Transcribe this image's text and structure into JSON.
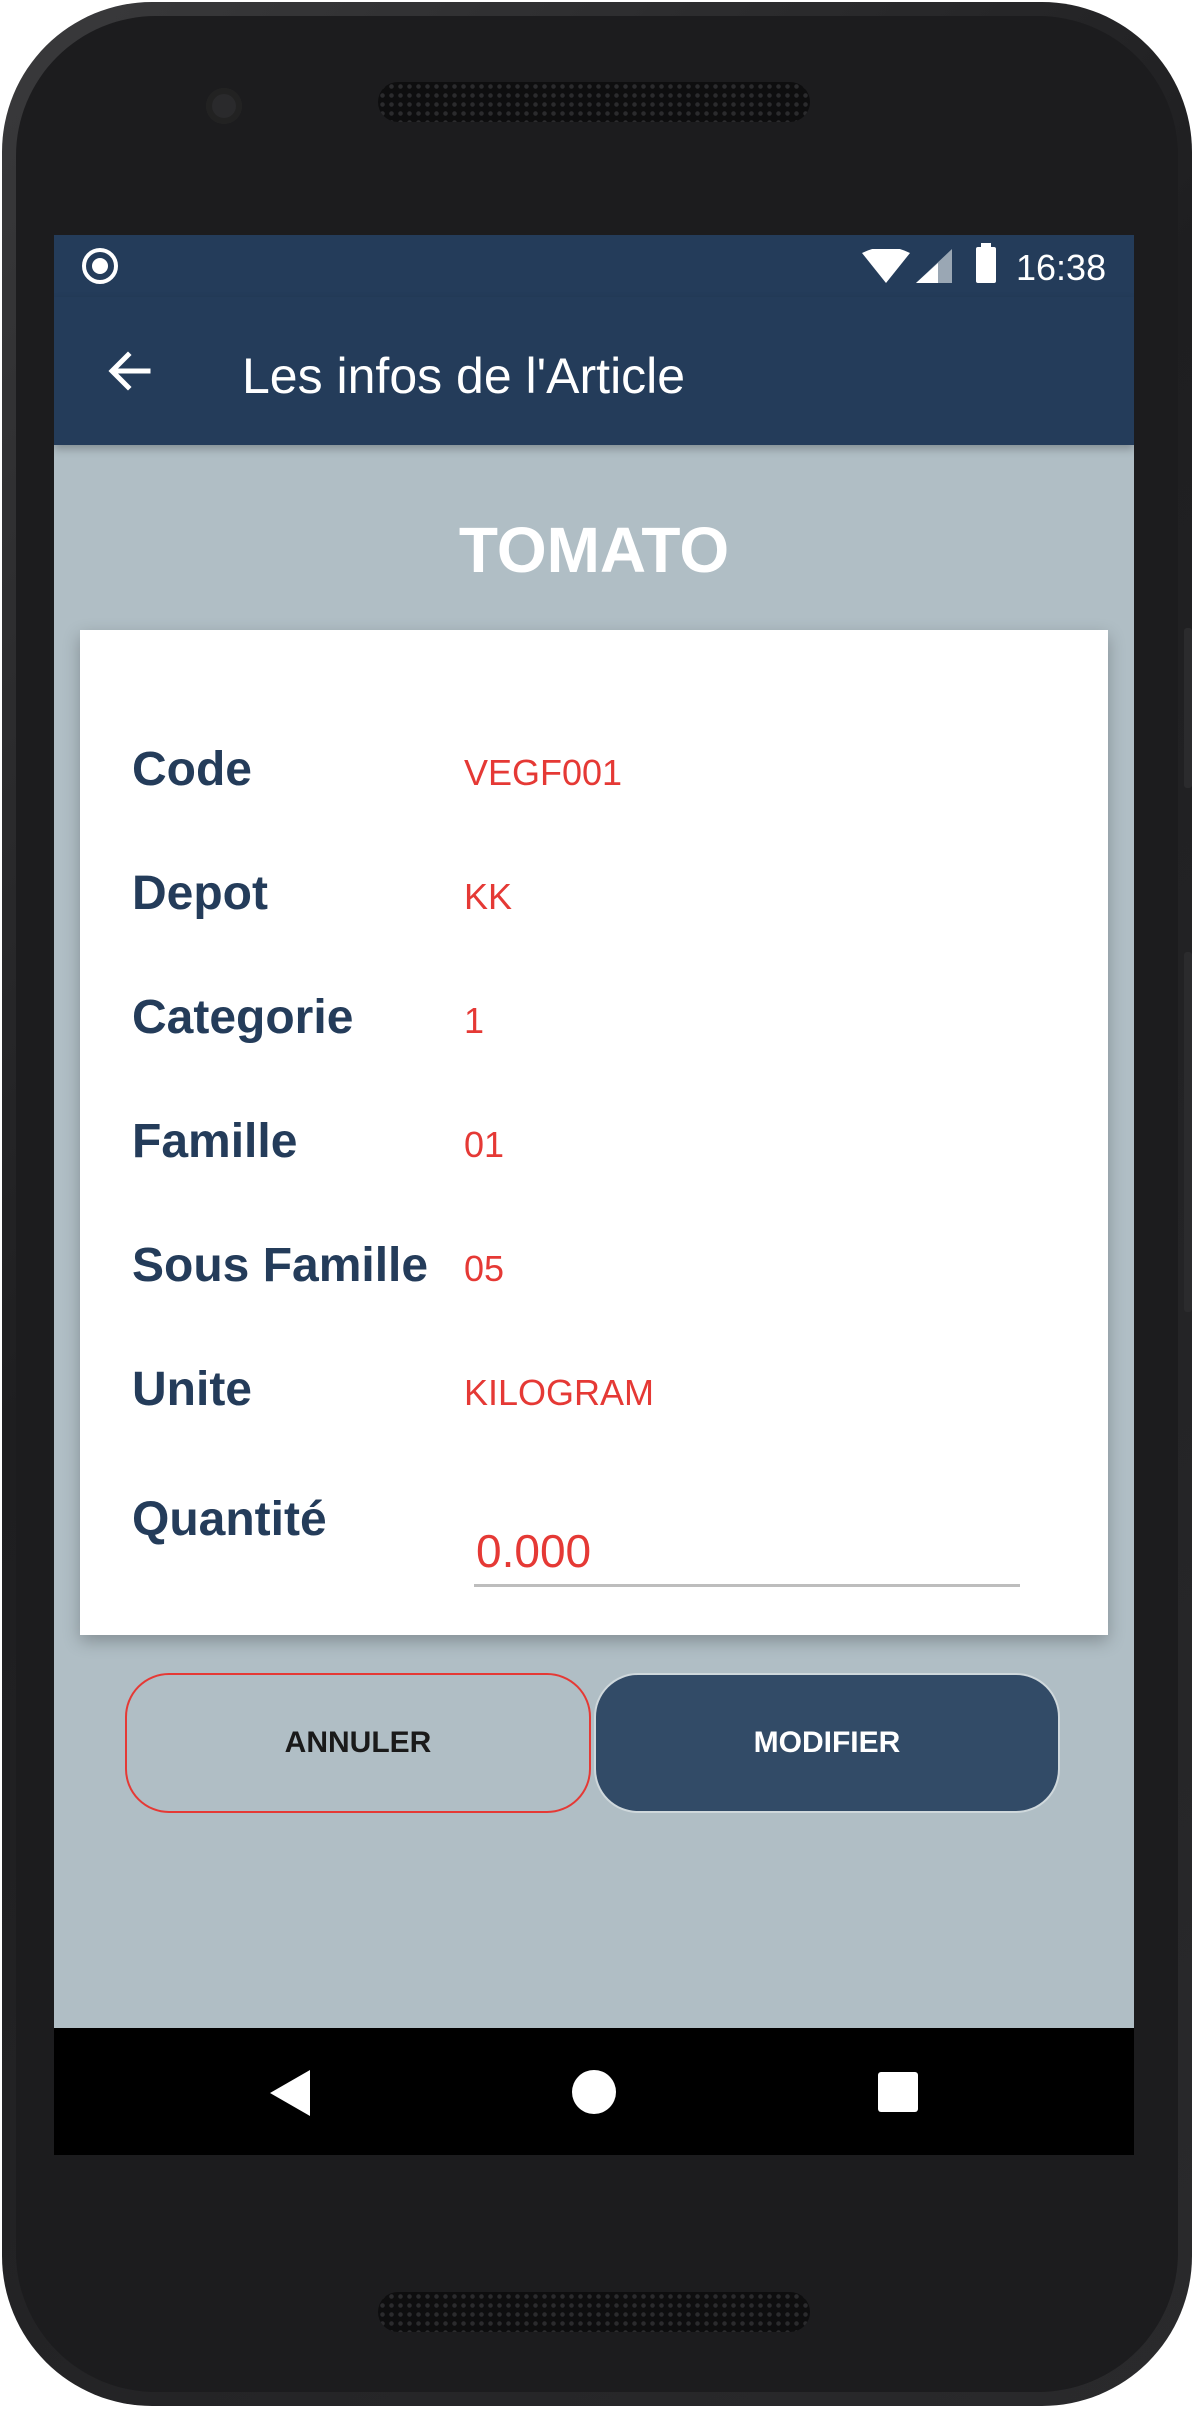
{
  "status_bar": {
    "time": "16:38"
  },
  "app_bar": {
    "title": "Les infos de l'Article"
  },
  "article": {
    "name": "TOMATO",
    "fields": [
      {
        "label": "Code",
        "value": "VEGF001"
      },
      {
        "label": "Depot",
        "value": "KK"
      },
      {
        "label": "Categorie",
        "value": "1"
      },
      {
        "label": "Famille",
        "value": "01"
      },
      {
        "label": "Sous Famille",
        "value": "05"
      },
      {
        "label": "Unite",
        "value": "KILOGRAM"
      }
    ],
    "quantity": {
      "label": "Quantité",
      "value": "0.000"
    }
  },
  "actions": {
    "cancel_label": "ANNULER",
    "modify_label": "MODIFIER"
  },
  "colors": {
    "primary": "#243c5a",
    "accent": "#e53935",
    "background": "#b0bec5",
    "button": "#324b67"
  },
  "icons": [
    "back-arrow-icon",
    "wifi-icon",
    "signal-icon",
    "battery-icon",
    "nav-back-icon",
    "nav-home-icon",
    "nav-recent-icon"
  ]
}
